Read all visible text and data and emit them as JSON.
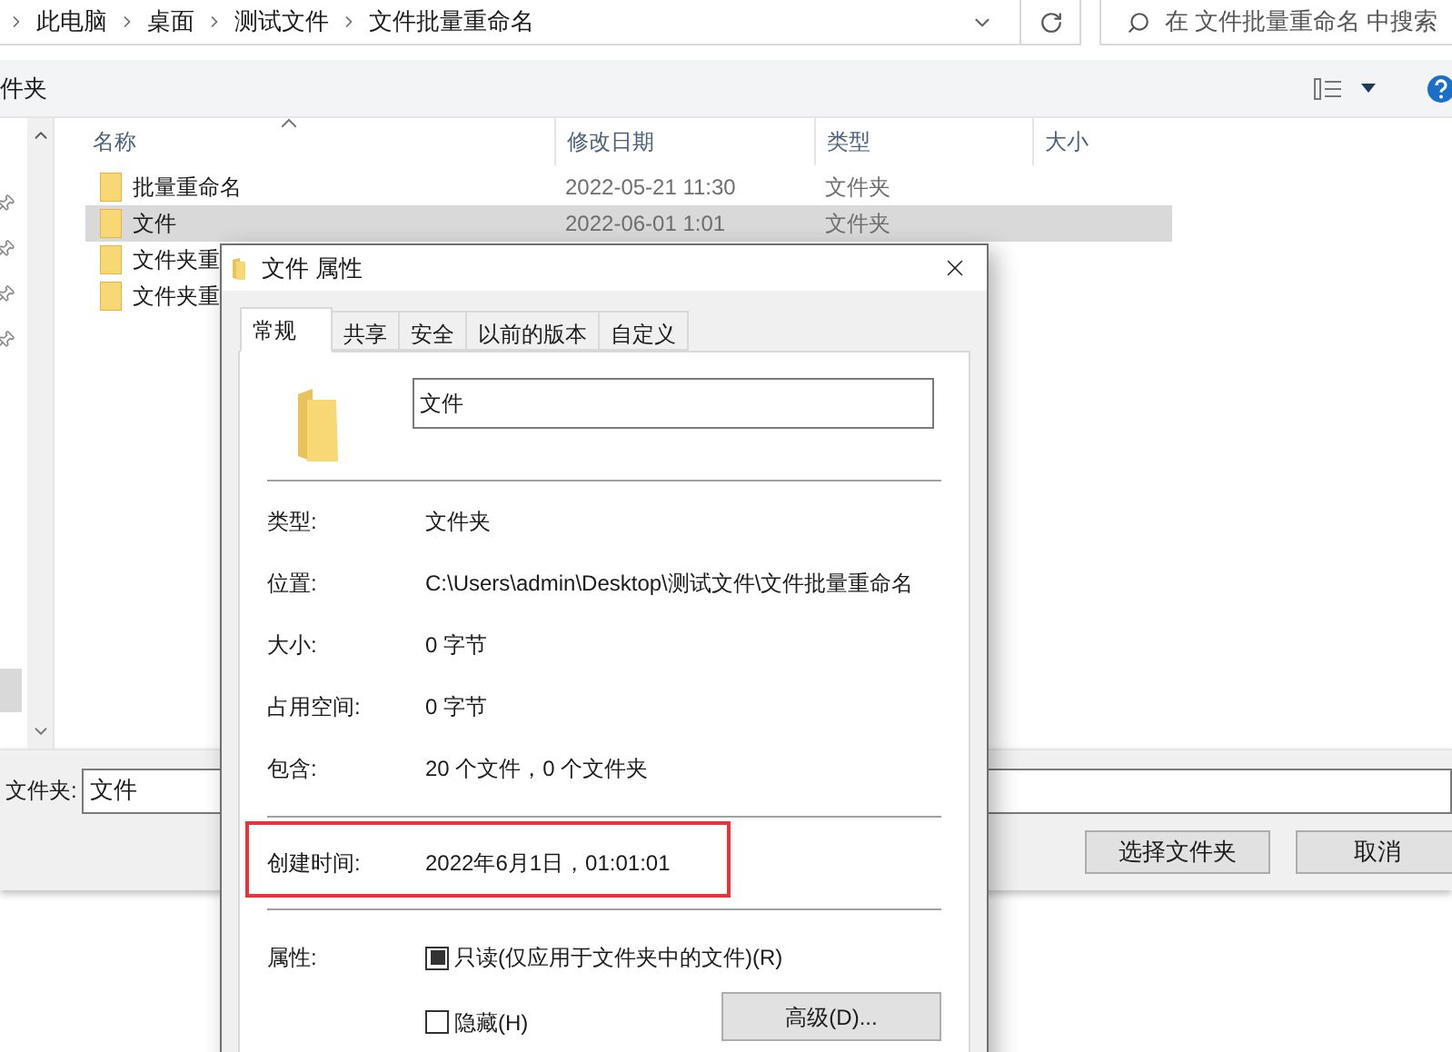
{
  "address_bar": {
    "crumbs": [
      "此电脑",
      "桌面",
      "测试文件",
      "文件批量重命名"
    ]
  },
  "search": {
    "placeholder": "在 文件批量重命名 中搜索"
  },
  "toolbar": {
    "label": "件夹"
  },
  "file_list": {
    "columns": [
      "名称",
      "修改日期",
      "类型",
      "大小"
    ],
    "rows": [
      {
        "name": "批量重命名",
        "date": "2022-05-21 11:30",
        "type": "文件夹",
        "selected": false
      },
      {
        "name": "文件",
        "date": "2022-06-01 1:01",
        "type": "文件夹",
        "selected": true
      },
      {
        "name": "文件夹重",
        "selected": false
      },
      {
        "name": "文件夹重",
        "selected": false
      }
    ]
  },
  "folder_field": {
    "label": "文件夹:",
    "value": "文件"
  },
  "buttons": [
    "选择文件夹",
    "取消"
  ],
  "properties": {
    "title": "文件 属性",
    "tabs": [
      {
        "label": "常规",
        "selected": true
      },
      {
        "label": "共享",
        "selected": false
      },
      {
        "label": "安全",
        "selected": false
      },
      {
        "label": "以前的版本",
        "selected": false
      },
      {
        "label": "自定义",
        "selected": false
      }
    ],
    "name": "文件",
    "info": [
      {
        "label": "类型:",
        "value": "文件夹"
      },
      {
        "label": "位置:",
        "value": "C:\\Users\\admin\\Desktop\\测试文件\\文件批量重命名"
      },
      {
        "label": "大小:",
        "value": "0 字节"
      },
      {
        "label": "占用空间:",
        "value": "0 字节"
      },
      {
        "label": "包含:",
        "value": "20 个文件，0 个文件夹"
      }
    ],
    "created": {
      "label": "创建时间:",
      "value": "2022年6月1日，01:01:01",
      "highlighted": true
    },
    "attributes_label": "属性:",
    "attributes": [
      {
        "label": "只读(仅应用于文件夹中的文件)(R)",
        "checked": true
      },
      {
        "label": "隐藏(H)",
        "checked": false
      }
    ],
    "advanced_button": "高级(D)..."
  }
}
